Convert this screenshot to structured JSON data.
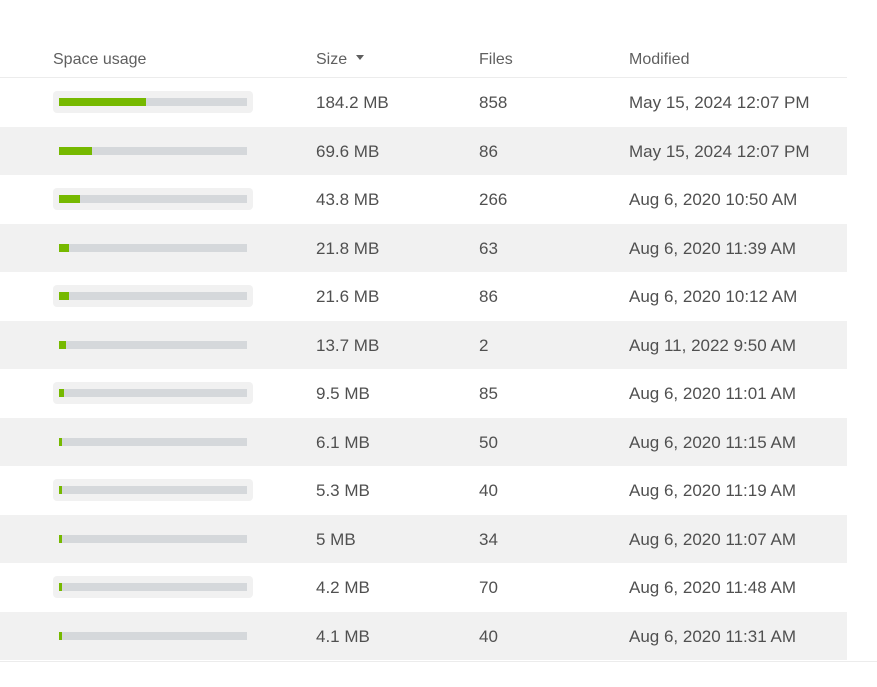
{
  "table": {
    "headers": {
      "space_usage": "Space usage",
      "size": "Size",
      "files": "Files",
      "modified": "Modified"
    },
    "sort": {
      "column": "Size",
      "direction": "descending",
      "icon": "caret-down-icon"
    },
    "accent_color": "#76b900",
    "track_color": "#d5d8db",
    "rows": [
      {
        "usage": 0.465,
        "size": "184.2 MB",
        "files": "858",
        "modified": "May 15, 2024 12:07 PM"
      },
      {
        "usage": 0.176,
        "size": "69.6 MB",
        "files": "86",
        "modified": "May 15, 2024 12:07 PM"
      },
      {
        "usage": 0.112,
        "size": "43.8 MB",
        "files": "266",
        "modified": "Aug 6, 2020 10:50 AM"
      },
      {
        "usage": 0.055,
        "size": "21.8 MB",
        "files": "63",
        "modified": "Aug 6, 2020 11:39 AM"
      },
      {
        "usage": 0.055,
        "size": "21.6 MB",
        "files": "86",
        "modified": "Aug 6, 2020 10:12 AM"
      },
      {
        "usage": 0.035,
        "size": "13.7 MB",
        "files": "2",
        "modified": "Aug 11, 2022 9:50 AM"
      },
      {
        "usage": 0.024,
        "size": "9.5 MB",
        "files": "85",
        "modified": "Aug 6, 2020 11:01 AM"
      },
      {
        "usage": 0.016,
        "size": "6.1 MB",
        "files": "50",
        "modified": "Aug 6, 2020 11:15 AM"
      },
      {
        "usage": 0.014,
        "size": "5.3 MB",
        "files": "40",
        "modified": "Aug 6, 2020 11:19 AM"
      },
      {
        "usage": 0.013,
        "size": "5 MB",
        "files": "34",
        "modified": "Aug 6, 2020 11:07 AM"
      },
      {
        "usage": 0.011,
        "size": "4.2 MB",
        "files": "70",
        "modified": "Aug 6, 2020 11:48 AM"
      },
      {
        "usage": 0.011,
        "size": "4.1 MB",
        "files": "40",
        "modified": "Aug 6, 2020 11:31 AM"
      }
    ]
  }
}
